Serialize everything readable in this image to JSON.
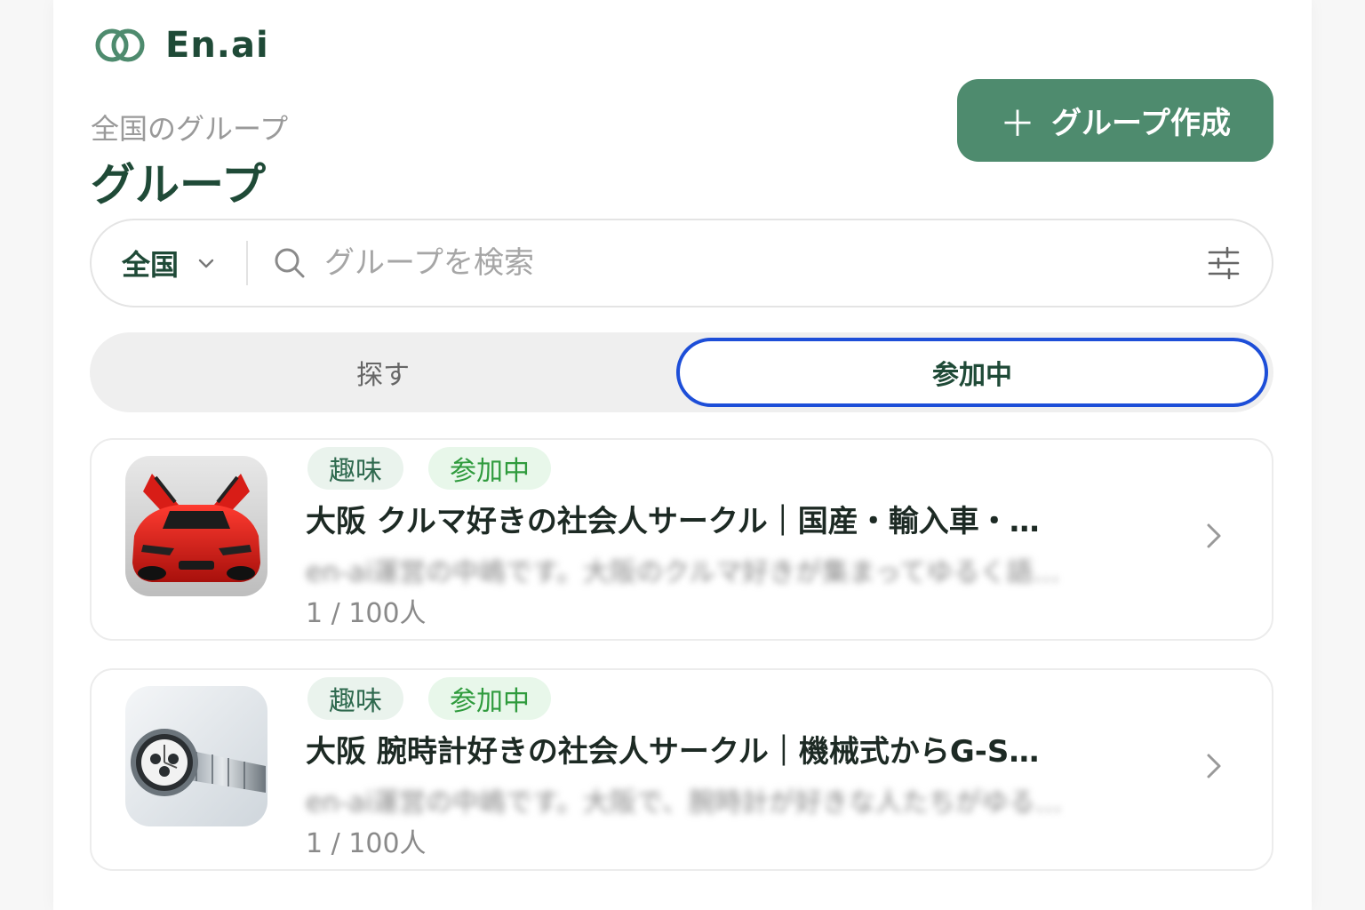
{
  "app": {
    "logo_text": "En.ai",
    "accent": "#4e8b6e",
    "brand_dark": "#1f4a37"
  },
  "header": {
    "breadcrumb": "全国のグループ",
    "title": "グループ",
    "create_button": "グループ作成"
  },
  "search": {
    "region": "全国",
    "placeholder": "グループを検索"
  },
  "tabs": [
    {
      "label": "探す",
      "active": false
    },
    {
      "label": "参加中",
      "active": true
    }
  ],
  "groups": [
    {
      "tags": [
        "趣味",
        "参加中"
      ],
      "title": "大阪 クルマ好きの社会人サークル｜国産・輸入車・…",
      "description": "en-ai運営の中嶋です。大阪のクルマ好きが集まってゆるく語…",
      "members": "1 / 100人"
    },
    {
      "tags": [
        "趣味",
        "参加中"
      ],
      "title": "大阪 腕時計好きの社会人サークル｜機械式からG-S…",
      "description": "en-ai運営の中嶋です。大阪で、腕時計が好きな人たちがゆる…",
      "members": "1 / 100人"
    }
  ]
}
